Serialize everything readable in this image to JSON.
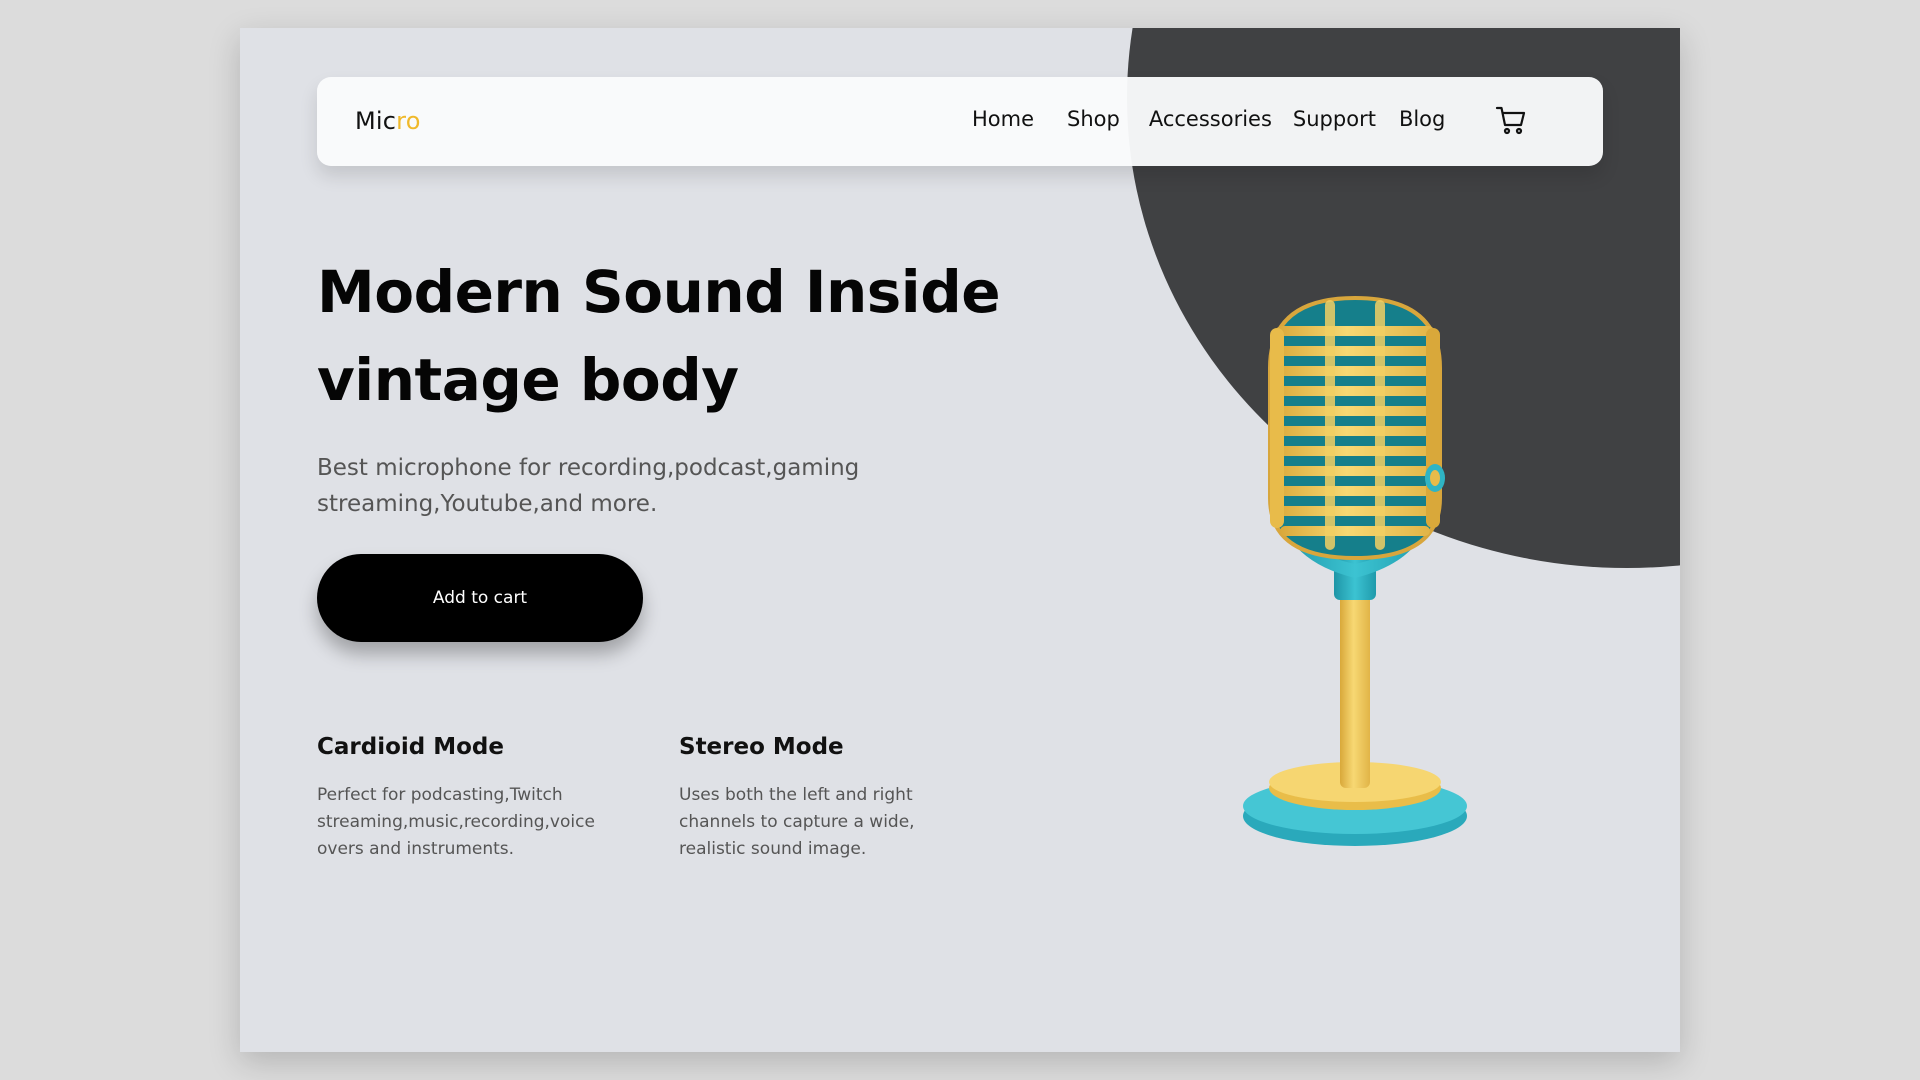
{
  "nav": {
    "logo_main": "Mic",
    "logo_accent": "ro",
    "links": [
      "Home",
      "Shop",
      "Accessories",
      "Support",
      "Blog"
    ],
    "cart_icon": "shopping-cart-icon"
  },
  "hero": {
    "title_line1": "Modern Sound Inside",
    "title_line2": "vintage body",
    "subtitle": "Best microphone for recording,podcast,gaming streaming,Youtube,and more.",
    "cta_label": "Add to cart"
  },
  "features": [
    {
      "title": "Cardioid Mode",
      "description": "Perfect for podcasting,Twitch streaming,music,recording,voice overs and instruments."
    },
    {
      "title": "Stereo Mode",
      "description": "Uses both the left and right channels to capture a wide, realistic sound image."
    }
  ],
  "product_image": "vintage-microphone-illustration",
  "colors": {
    "accent": "#f0b92b",
    "dark_circle": "#404143",
    "background": "#dfe1e6",
    "button": "#000000",
    "mic_yellow": "#f2cf63",
    "mic_teal": "#2fb4c4"
  }
}
